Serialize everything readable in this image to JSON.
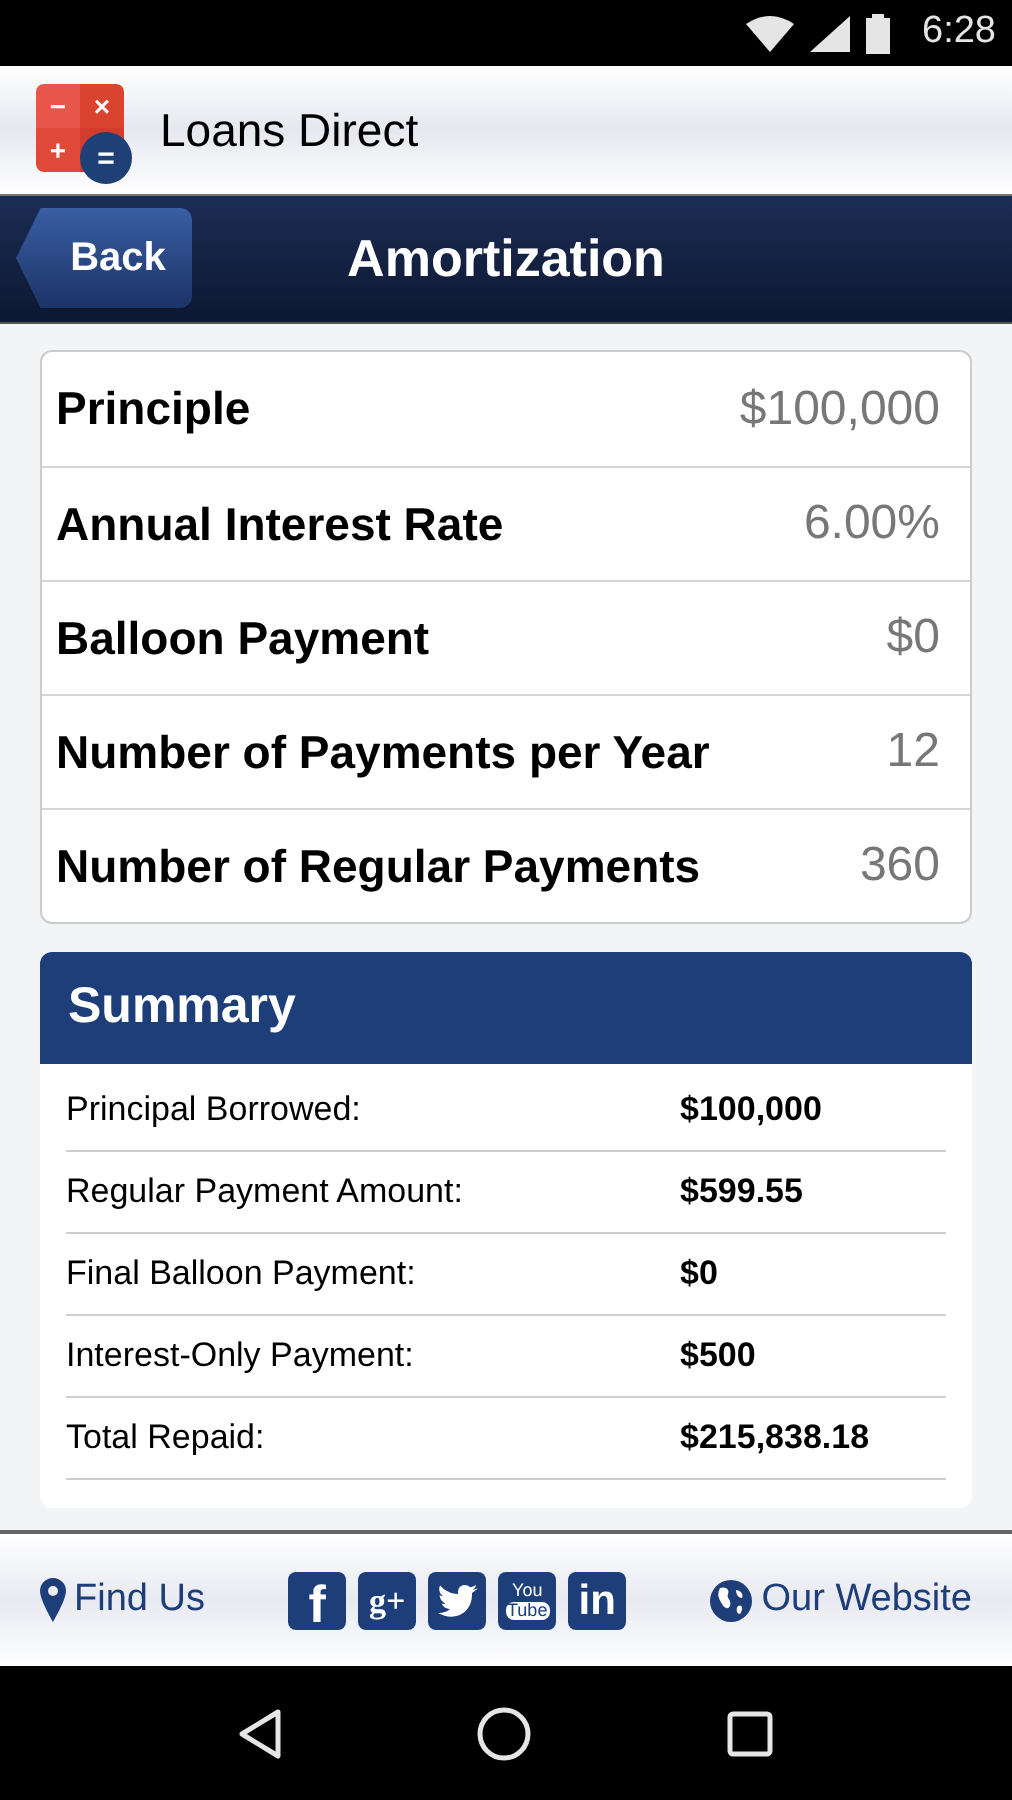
{
  "status_bar": {
    "time": "6:28"
  },
  "app_header": {
    "title": "Loans Direct",
    "logo_signs": [
      "−",
      "×",
      "+",
      "="
    ]
  },
  "nav_bar": {
    "back": "Back",
    "title": "Amortization"
  },
  "inputs": [
    {
      "label": "Principle",
      "value": "$100,000"
    },
    {
      "label": "Annual Interest Rate",
      "value": "6.00%"
    },
    {
      "label": "Balloon Payment",
      "value": "$0"
    },
    {
      "label": "Number of Payments per Year",
      "value": "12"
    },
    {
      "label": "Number of Regular Payments",
      "value": "360"
    }
  ],
  "summary": {
    "title": "Summary",
    "rows": [
      {
        "label": "Principal Borrowed:",
        "value": "$100,000"
      },
      {
        "label": "Regular Payment Amount:",
        "value": "$599.55"
      },
      {
        "label": "Final Balloon Payment:",
        "value": "$0"
      },
      {
        "label": "Interest-Only Payment:",
        "value": "$500"
      },
      {
        "label": "Total Repaid:",
        "value": "$215,838.18"
      }
    ]
  },
  "footer": {
    "find_us": "Find Us",
    "social": [
      {
        "kind": "facebook",
        "label": "f"
      },
      {
        "kind": "googleplus",
        "label": "g+"
      },
      {
        "kind": "twitter"
      },
      {
        "kind": "youtube",
        "label": "You Tube"
      },
      {
        "kind": "linkedin",
        "label": "in"
      }
    ],
    "website": "Our Website"
  }
}
